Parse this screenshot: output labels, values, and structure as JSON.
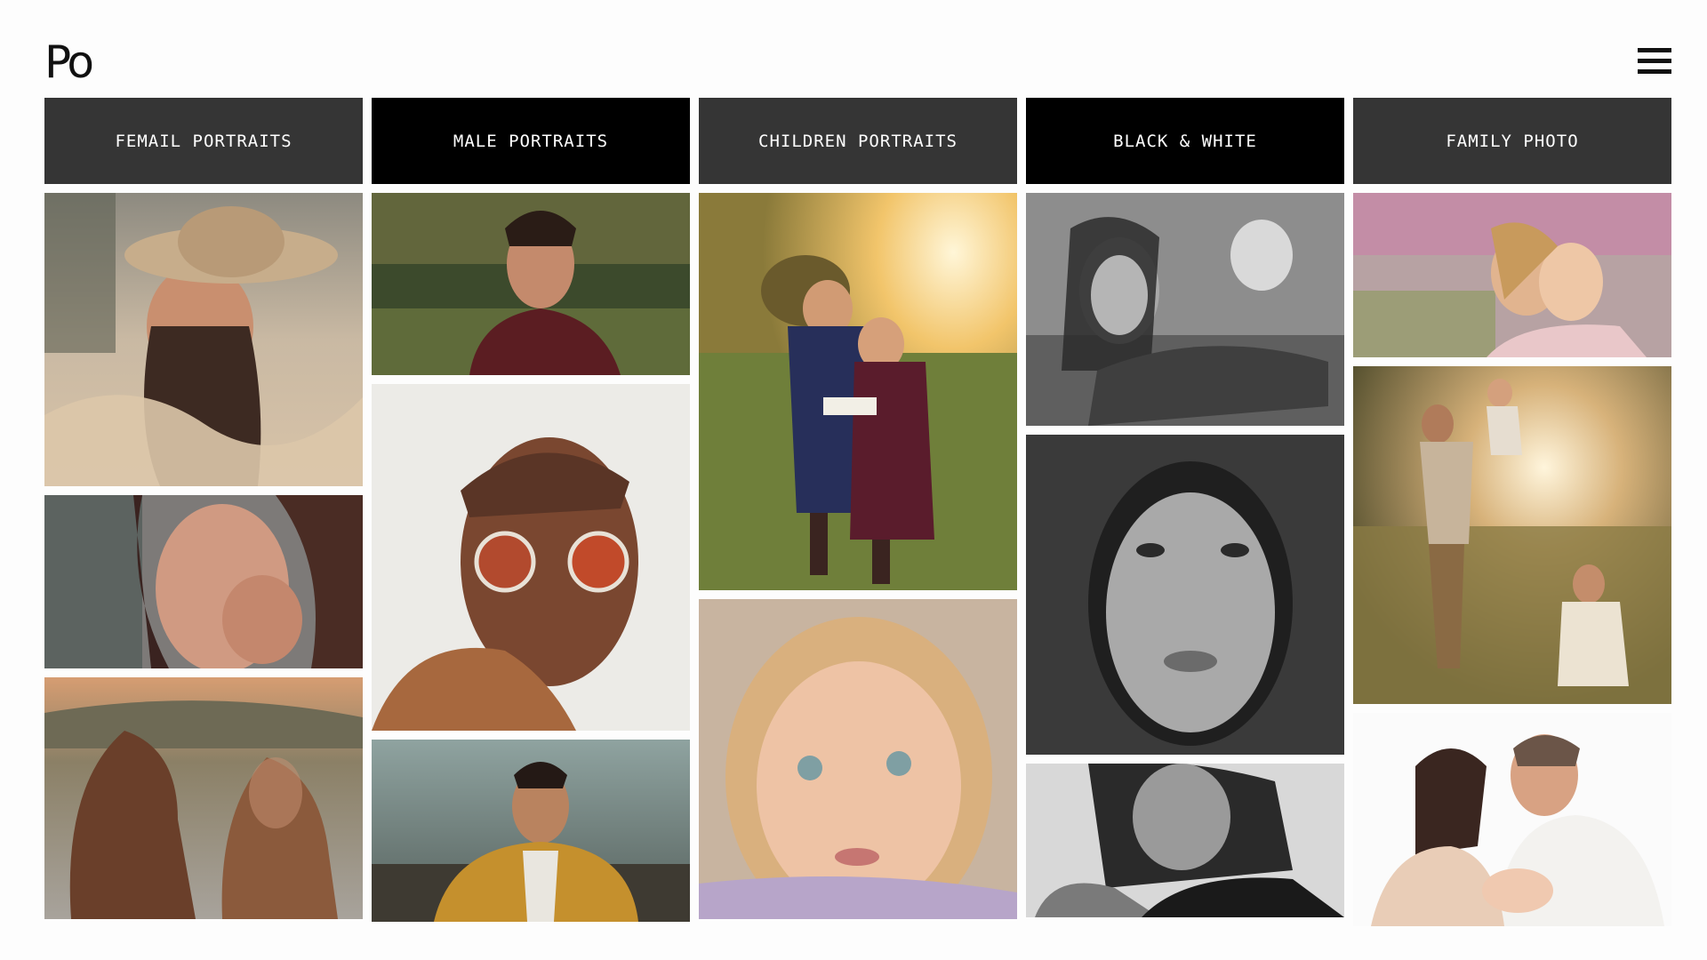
{
  "brand": {
    "logo_text": "Po"
  },
  "menu": {
    "icon": "hamburger-menu-icon"
  },
  "categories": [
    {
      "label": "FEMAIL PORTRAITS",
      "style": "dark"
    },
    {
      "label": "MALE PORTRAITS",
      "style": "black"
    },
    {
      "label": "CHILDREN PORTRAITS",
      "style": "dark"
    },
    {
      "label": "BLACK & WHITE",
      "style": "black"
    },
    {
      "label": "FAMILY PHOTO",
      "style": "dark"
    }
  ],
  "photos": {
    "female": [
      "Woman in straw hat among wheat",
      "Woman smiling, hand in hair",
      "Two girls overlooking a coastal town"
    ],
    "male": [
      "Bearded man in maroon t-shirt outdoors",
      "Man with round orange sunglasses",
      "Man in mustard jacket at the beach"
    ],
    "children": [
      "Two girls reading a book in a sunny field",
      "Curly-haired toddler close-up"
    ],
    "bw": [
      "Woman lying in shallow water",
      "Woman close-up portrait",
      "Woman with earring, hands clasped"
    ],
    "family": [
      "Mother and daughter hugging under blossoms",
      "Father lifting child, mother sitting in grass",
      "Couple with newborn"
    ]
  },
  "colors": {
    "category_dark": "#353535",
    "category_black": "#000000",
    "background": "#fdfdfd"
  }
}
